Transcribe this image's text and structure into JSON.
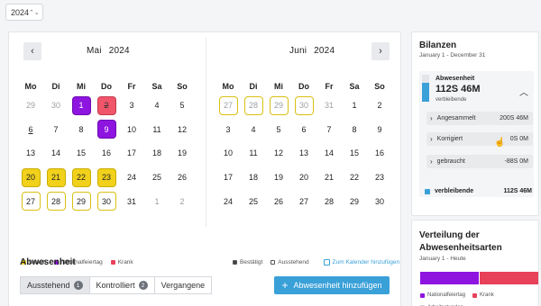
{
  "year_select": {
    "value": "2024"
  },
  "calendar": {
    "weekdays": [
      "Mo",
      "Di",
      "Mi",
      "Do",
      "Fr",
      "Sa",
      "So"
    ],
    "left": {
      "month": "Mai",
      "year": "2024",
      "prev_icon": "‹",
      "days": [
        {
          "d": "29",
          "t": "muted"
        },
        {
          "d": "30",
          "t": "muted"
        },
        {
          "d": "1",
          "t": "national"
        },
        {
          "d": "2",
          "t": "krank strike"
        },
        {
          "d": "3",
          "t": ""
        },
        {
          "d": "4",
          "t": ""
        },
        {
          "d": "5",
          "t": ""
        },
        {
          "d": "6",
          "t": "under"
        },
        {
          "d": "7",
          "t": ""
        },
        {
          "d": "8",
          "t": ""
        },
        {
          "d": "9",
          "t": "national"
        },
        {
          "d": "10",
          "t": ""
        },
        {
          "d": "11",
          "t": ""
        },
        {
          "d": "12",
          "t": ""
        },
        {
          "d": "13",
          "t": ""
        },
        {
          "d": "14",
          "t": ""
        },
        {
          "d": "15",
          "t": ""
        },
        {
          "d": "16",
          "t": ""
        },
        {
          "d": "17",
          "t": ""
        },
        {
          "d": "18",
          "t": ""
        },
        {
          "d": "19",
          "t": ""
        },
        {
          "d": "20",
          "t": "urlaub"
        },
        {
          "d": "21",
          "t": "urlaub"
        },
        {
          "d": "22",
          "t": "urlaub"
        },
        {
          "d": "23",
          "t": "urlaub"
        },
        {
          "d": "24",
          "t": ""
        },
        {
          "d": "25",
          "t": ""
        },
        {
          "d": "26",
          "t": ""
        },
        {
          "d": "27",
          "t": "pending"
        },
        {
          "d": "28",
          "t": "pending"
        },
        {
          "d": "29",
          "t": "pending"
        },
        {
          "d": "30",
          "t": "pending"
        },
        {
          "d": "31",
          "t": ""
        },
        {
          "d": "1",
          "t": "muted"
        },
        {
          "d": "2",
          "t": "muted"
        }
      ]
    },
    "right": {
      "month": "Juni",
      "year": "2024",
      "next_icon": "›",
      "days": [
        {
          "d": "27",
          "t": "pending muted"
        },
        {
          "d": "28",
          "t": "pending muted"
        },
        {
          "d": "29",
          "t": "pending muted"
        },
        {
          "d": "30",
          "t": "pending muted"
        },
        {
          "d": "31",
          "t": "muted"
        },
        {
          "d": "1",
          "t": ""
        },
        {
          "d": "2",
          "t": ""
        },
        {
          "d": "3",
          "t": ""
        },
        {
          "d": "4",
          "t": ""
        },
        {
          "d": "5",
          "t": ""
        },
        {
          "d": "6",
          "t": ""
        },
        {
          "d": "7",
          "t": ""
        },
        {
          "d": "8",
          "t": ""
        },
        {
          "d": "9",
          "t": ""
        },
        {
          "d": "10",
          "t": ""
        },
        {
          "d": "11",
          "t": ""
        },
        {
          "d": "12",
          "t": ""
        },
        {
          "d": "13",
          "t": ""
        },
        {
          "d": "14",
          "t": ""
        },
        {
          "d": "15",
          "t": ""
        },
        {
          "d": "16",
          "t": ""
        },
        {
          "d": "17",
          "t": ""
        },
        {
          "d": "18",
          "t": ""
        },
        {
          "d": "19",
          "t": ""
        },
        {
          "d": "20",
          "t": ""
        },
        {
          "d": "21",
          "t": ""
        },
        {
          "d": "22",
          "t": ""
        },
        {
          "d": "23",
          "t": ""
        },
        {
          "d": "24",
          "t": ""
        },
        {
          "d": "25",
          "t": ""
        },
        {
          "d": "26",
          "t": ""
        },
        {
          "d": "27",
          "t": ""
        },
        {
          "d": "28",
          "t": ""
        },
        {
          "d": "29",
          "t": ""
        },
        {
          "d": "30",
          "t": ""
        }
      ]
    },
    "legend_left": [
      {
        "label": "Urlaub",
        "color": "#f1d11c"
      },
      {
        "label": "Nationalfeiertag",
        "color": "#8e14e0"
      },
      {
        "label": "Krank",
        "color": "#e8415a"
      }
    ],
    "legend_right": [
      {
        "label": "Bestätigt",
        "color": "#444444"
      },
      {
        "label": "Ausstehend",
        "color": "#ffffff"
      }
    ],
    "add_calendar_link": "Zum Kalender hinzufügen"
  },
  "absence": {
    "title": "Abwesenheit",
    "tabs": [
      {
        "label": "Ausstehend",
        "badge": "1"
      },
      {
        "label": "Kontrolliert",
        "badge": "2"
      },
      {
        "label": "Vergangene",
        "badge": ""
      }
    ],
    "add_button": "Abwesenheit hinzufügen"
  },
  "balances": {
    "title": "Bilanzen",
    "range": "January 1 - December 31",
    "card": {
      "label": "Abwesenheit",
      "value": "112S 46M",
      "sublabel": "verbleibende"
    },
    "rows": [
      {
        "label": "Angesammelt",
        "value": "200S 46M"
      },
      {
        "label": "Korrigiert",
        "value": "0S 0M"
      },
      {
        "label": "gebraucht",
        "value": "-88S 0M"
      }
    ],
    "remaining": {
      "label": "verbleibende",
      "value": "112S 46M"
    },
    "accent": "#3aa0d8"
  },
  "distribution": {
    "title": "Verteilung der Abwesenheitsarten",
    "range": "January 1 - Heute",
    "legend": [
      {
        "label": "Nationalfeiertag",
        "color": "#8e14e0"
      },
      {
        "label": "Krank",
        "color": "#e8415a"
      },
      {
        "label": "Arbeitsstunden",
        "color": "#cccccc"
      }
    ]
  }
}
